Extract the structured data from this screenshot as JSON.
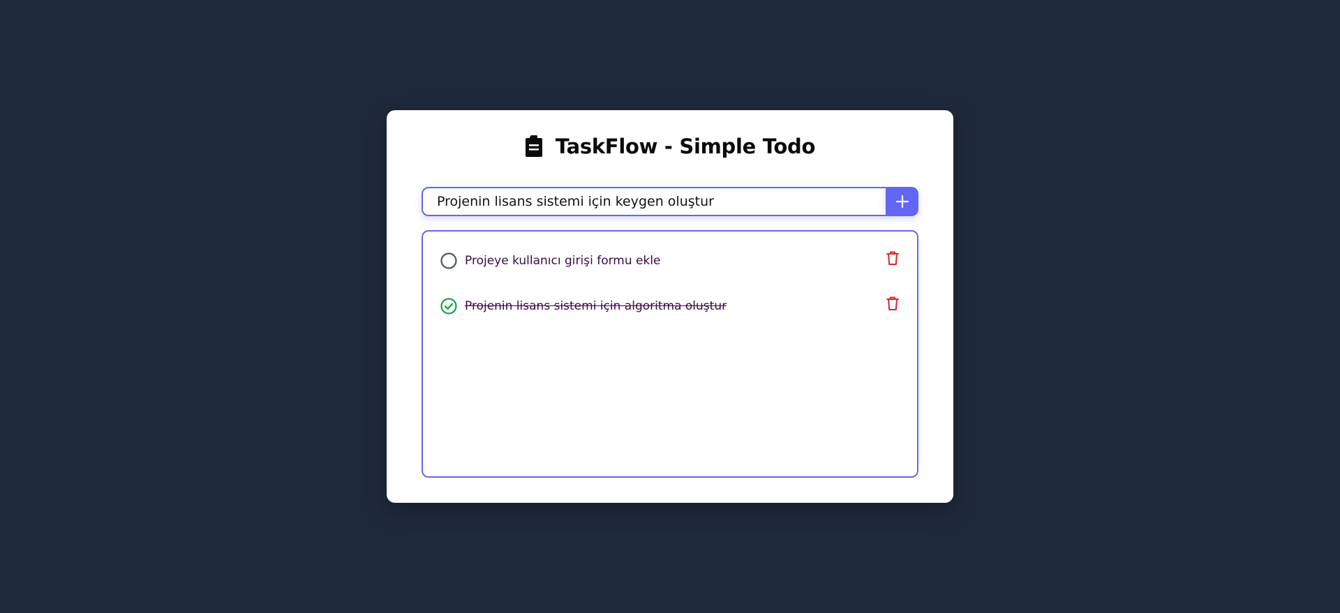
{
  "app": {
    "title": "TaskFlow - Simple Todo",
    "header_icon": "clipboard-icon"
  },
  "input": {
    "value": "Projenin lisans sistemi için keygen oluştur",
    "add_button_icon": "plus-icon"
  },
  "todos": [
    {
      "text": "Projeye kullanıcı girişi formu ekle",
      "completed": false,
      "toggle_icon": "circle-icon",
      "delete_icon": "trash-icon"
    },
    {
      "text": "Projenin lisans sistemi için algoritma oluştur",
      "completed": true,
      "toggle_icon": "check-circle-icon",
      "delete_icon": "trash-icon"
    }
  ],
  "colors": {
    "background": "#1e293b",
    "card": "#ffffff",
    "accent": "#6366f1",
    "todo_text": "#3b0a45",
    "complete": "#16a34a",
    "delete": "#dc2626",
    "incomplete_circle": "#4b5563"
  }
}
